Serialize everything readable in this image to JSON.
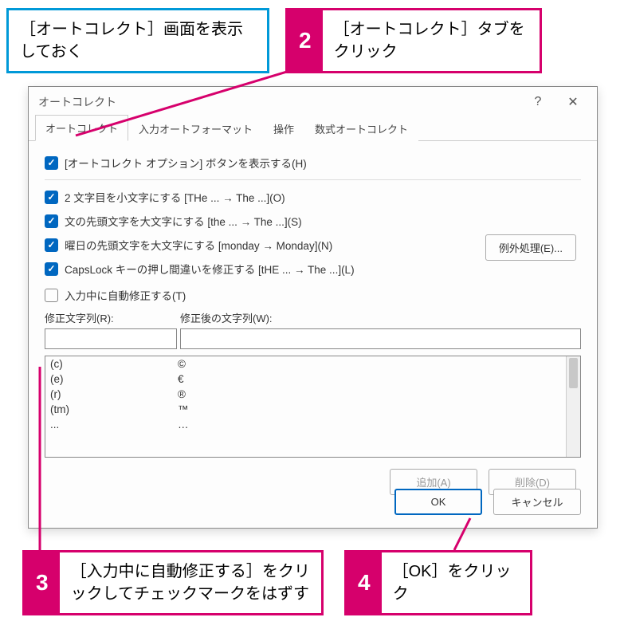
{
  "callouts": {
    "c1": {
      "text": "［オートコレクト］画面を表示しておく"
    },
    "c2": {
      "num": "2",
      "text": "［オートコレクト］タブをクリック"
    },
    "c3": {
      "num": "3",
      "text": "［入力中に自動修正する］をクリックしてチェックマークをはずす"
    },
    "c4": {
      "num": "4",
      "text": "［OK］をクリック"
    }
  },
  "dialog": {
    "title": "オートコレクト",
    "help": "?",
    "close": "✕",
    "tabs": {
      "t1": "オートコレクト",
      "t2": "入力オートフォーマット",
      "t3": "操作",
      "t4": "数式オートコレクト"
    },
    "options": {
      "o1": "[オートコレクト オプション] ボタンを表示する(H)",
      "o2": "2 文字目を小文字にする [THe ... → The ...](O)",
      "o3": "文の先頭文字を大文字にする [the ... → The ...](S)",
      "o4": "曜日の先頭文字を大文字にする [monday → Monday](N)",
      "o5": "CapsLock キーの押し間違いを修正する [tHE ... → The ...](L)",
      "o6": "入力中に自動修正する(T)"
    },
    "exceptions": "例外処理(E)...",
    "labels": {
      "left": "修正文字列(R):",
      "right": "修正後の文字列(W):"
    },
    "rows": {
      "r0": {
        "a": "(c)",
        "b": "©"
      },
      "r1": {
        "a": "(e)",
        "b": "€"
      },
      "r2": {
        "a": "(r)",
        "b": "®"
      },
      "r3": {
        "a": "(tm)",
        "b": "™"
      },
      "r4": {
        "a": "...",
        "b": "…"
      }
    },
    "add": "追加(A)",
    "del": "削除(D)",
    "ok": "OK",
    "cancel": "キャンセル"
  }
}
